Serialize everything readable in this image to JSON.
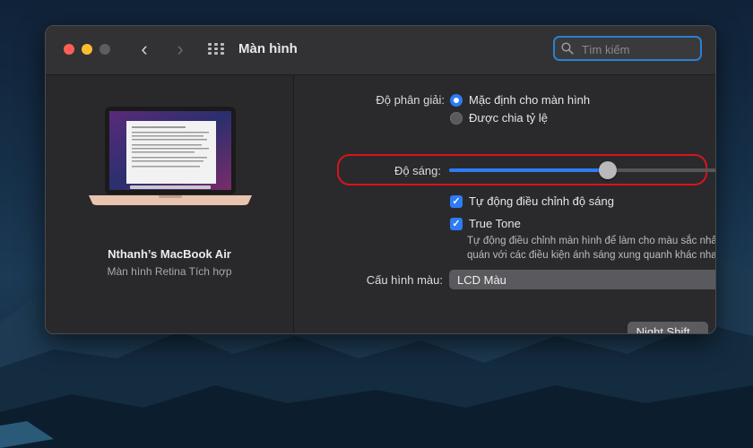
{
  "window": {
    "title": "Màn hình",
    "search_placeholder": "Tìm kiếm"
  },
  "icons": {
    "back": "‹",
    "forward": "›",
    "grid": "grid-icon",
    "search": "search-icon",
    "laptop": "macbook-icon"
  },
  "sidebar": {
    "device_name": "Nthanh’s MacBook Air",
    "device_subtitle": "Màn hình Retina Tích hợp"
  },
  "display": {
    "resolution_label": "Độ phân giải:",
    "resolution_options": [
      {
        "label": "Mặc định cho màn hình",
        "selected": true
      },
      {
        "label": "Được chia tỷ lệ",
        "selected": false
      }
    ],
    "brightness_label": "Độ sáng:",
    "brightness_level": 0.55,
    "auto_brightness_label": "Tự động điều chỉnh độ sáng",
    "auto_brightness_checked": true,
    "true_tone_label": "True Tone",
    "true_tone_checked": true,
    "true_tone_desc_line1": "Tự động điều chỉnh màn hình để làm cho màu sắc nhất",
    "true_tone_desc_line2": "quán với các điều kiện ánh sáng xung quanh khác nhau.",
    "color_profile_label": "Cấu hình màu:",
    "color_profile_value": "LCD Màu",
    "night_shift_button": "Night Shift...",
    "help_button": "?"
  },
  "colors": {
    "accent": "#2c7cf6",
    "highlight_ring": "#d8141c",
    "close": "#ff5f57",
    "minimize": "#febc2e"
  }
}
